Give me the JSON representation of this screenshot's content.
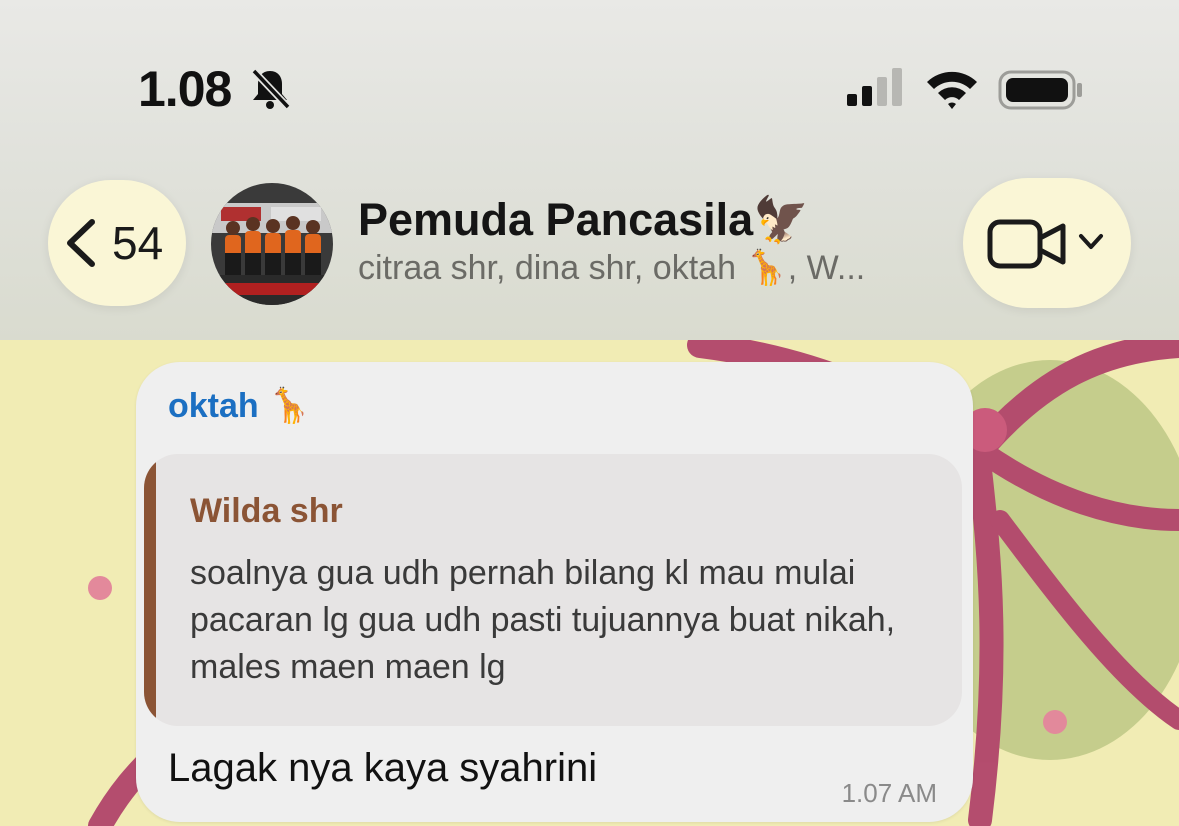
{
  "status_bar": {
    "time": "1.08",
    "icons": [
      "bell-slash-icon",
      "cellular-signal-icon",
      "wifi-icon",
      "battery-icon"
    ]
  },
  "header": {
    "back_count": "54",
    "title": "Pemuda Pancasila🦅",
    "subtitle": "citraa shr, dina shr, oktah 🦒, W..."
  },
  "message": {
    "sender": "oktah 🦒",
    "quote": {
      "author": "Wilda shr",
      "text": "soalnya gua udh pernah bilang kl mau mulai pacaran lg gua udh pasti tujuannya buat nikah, males maen maen lg"
    },
    "text": "Lagak nya kaya syahrini",
    "time": "1.07 AM"
  },
  "colors": {
    "sender_name": "#1b6fc2",
    "quote_accent": "#8b5435",
    "header_buttons": "#faf6d6",
    "wallpaper": "#f1ecb4"
  }
}
